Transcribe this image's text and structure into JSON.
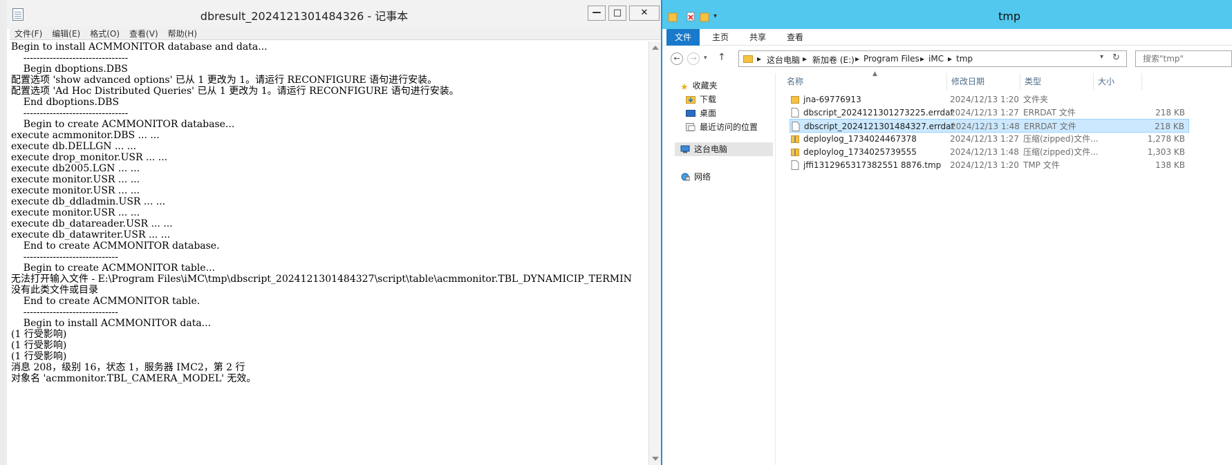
{
  "notepad": {
    "title": "dbresult_2024121301484326 - 记事本",
    "controls": {
      "minimize": "—",
      "maximize": "□",
      "close": "✕"
    },
    "menu": [
      "文件(F)",
      "编辑(E)",
      "格式(O)",
      "查看(V)",
      "帮助(H)"
    ],
    "lines": [
      "Begin to install ACMMONITOR database and data...",
      "    --------------------------------",
      "    Begin dboptions.DBS",
      "配置选项 'show advanced options' 已从 1 更改为 1。请运行 RECONFIGURE 语句进行安装。",
      "配置选项 'Ad Hoc Distributed Queries' 已从 1 更改为 1。请运行 RECONFIGURE 语句进行安装。",
      "    End dboptions.DBS",
      "    --------------------------------",
      "    Begin to create ACMMONITOR database...",
      "execute acmmonitor.DBS ... ...",
      "execute db.DELLGN ... ...",
      "execute drop_monitor.USR ... ...",
      "execute db2005.LGN ... ...",
      "execute monitor.USR ... ...",
      "execute monitor.USR ... ...",
      "execute db_ddladmin.USR ... ...",
      "execute monitor.USR ... ...",
      "execute db_datareader.USR ... ...",
      "execute db_datawriter.USR ... ...",
      "    End to create ACMMONITOR database.",
      "    -----------------------------",
      "    Begin to create ACMMONITOR table...",
      "无法打开输入文件 - E:\\Program Files\\iMC\\tmp\\dbscript_2024121301484327\\script\\table\\acmmonitor.TBL_DYNAMICIP_TERMIN",
      "没有此类文件或目录",
      "    End to create ACMMONITOR table.",
      "    -----------------------------",
      "    Begin to install ACMMONITOR data...",
      "(1 行受影响)",
      "(1 行受影响)",
      "(1 行受影响)",
      "消息 208，级别 16，状态 1，服务器 IMC2，第 2 行",
      "对象名 'acmmonitor.TBL_CAMERA_MODEL' 无效。"
    ]
  },
  "explorer": {
    "title": "tmp",
    "ribbon_tabs": [
      "文件",
      "主页",
      "共享",
      "查看"
    ],
    "breadcrumb": [
      "这台电脑",
      "新加卷 (E:)",
      "Program Files",
      "iMC",
      "tmp"
    ],
    "search_placeholder": "搜索\"tmp\"",
    "nav": {
      "favorites": "收藏夹",
      "downloads": "下载",
      "desktop": "桌面",
      "recent": "最近访问的位置",
      "this_pc": "这台电脑",
      "network": "网络"
    },
    "columns": [
      "名称",
      "修改日期",
      "类型",
      "大小"
    ],
    "files": [
      {
        "name": "jna-69776913",
        "date": "2024/12/13 1:20",
        "type": "文件夹",
        "size": "",
        "kind": "folder"
      },
      {
        "name": "dbscript_2024121301273225.errdat",
        "date": "2024/12/13 1:27",
        "type": "ERRDAT 文件",
        "size": "218 KB",
        "kind": "file"
      },
      {
        "name": "dbscript_2024121301484327.errdat",
        "date": "2024/12/13 1:48",
        "type": "ERRDAT 文件",
        "size": "218 KB",
        "kind": "file"
      },
      {
        "name": "deploylog_1734024467378",
        "date": "2024/12/13 1:27",
        "type": "压缩(zipped)文件...",
        "size": "1,278 KB",
        "kind": "zip"
      },
      {
        "name": "deploylog_1734025739555",
        "date": "2024/12/13 1:48",
        "type": "压缩(zipped)文件...",
        "size": "1,303 KB",
        "kind": "zip"
      },
      {
        "name": "jffi1312965317382551 8876.tmp",
        "date": "2024/12/13 1:20",
        "type": "TMP 文件",
        "size": "138 KB",
        "kind": "file"
      }
    ]
  },
  "colors": {
    "explorer_title": "#52c8ee",
    "ribbon_file": "#1979ca",
    "selection": "#cce8ff"
  }
}
